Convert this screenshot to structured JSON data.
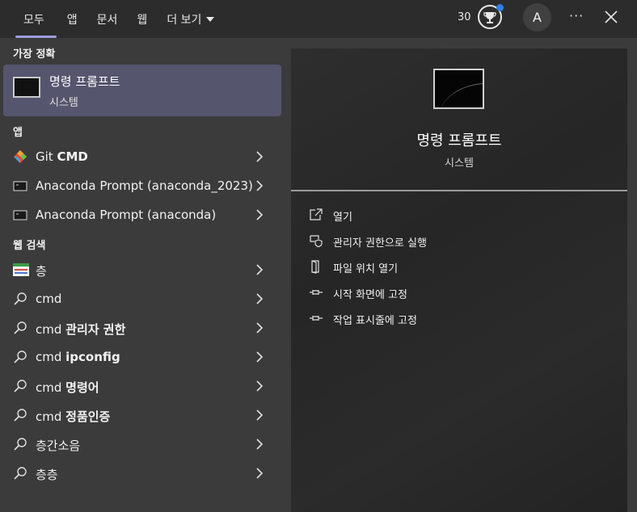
{
  "tabs": [
    {
      "label": "모두",
      "active": true
    },
    {
      "label": "앱"
    },
    {
      "label": "문서"
    },
    {
      "label": "웹"
    },
    {
      "label": "더 보기"
    }
  ],
  "header": {
    "points": "30",
    "avatar_initial": "A",
    "more_label": "···"
  },
  "best_match": {
    "section_label": "가장 정확",
    "title": "명령 프롬프트",
    "subtitle": "시스템"
  },
  "apps": {
    "section_label": "앱",
    "items": [
      {
        "label_plain": "Git ",
        "label_bold": "CMD",
        "icon": "git-icon"
      },
      {
        "label_plain": "Anaconda Prompt (anaconda_2023)",
        "label_bold": "",
        "icon": "terminal-icon"
      },
      {
        "label_plain": "Anaconda Prompt (anaconda)",
        "label_bold": "",
        "icon": "terminal-icon"
      }
    ]
  },
  "web": {
    "section_label": "웹 검색",
    "items": [
      {
        "label_plain": "층",
        "label_bold": "",
        "icon": "web-thumbnail-icon"
      },
      {
        "label_plain": "cmd",
        "label_bold": "",
        "icon": "search-icon"
      },
      {
        "label_plain": "cmd ",
        "label_bold": "관리자 권한",
        "icon": "search-icon"
      },
      {
        "label_plain": "cmd ",
        "label_bold": "ipconfig",
        "icon": "search-icon"
      },
      {
        "label_plain": "cmd ",
        "label_bold": "명령어",
        "icon": "search-icon"
      },
      {
        "label_plain": "cmd ",
        "label_bold": "정품인증",
        "icon": "search-icon"
      },
      {
        "label_plain": "층간소음",
        "label_bold": "",
        "icon": "search-icon"
      },
      {
        "label_plain": "층층",
        "label_bold": "",
        "icon": "search-icon"
      }
    ]
  },
  "detail": {
    "title": "명령 프롬프트",
    "subtitle": "시스템",
    "actions": [
      {
        "label": "열기",
        "icon": "open-icon"
      },
      {
        "label": "관리자 권한으로 실행",
        "icon": "shield-icon"
      },
      {
        "label": "파일 위치 열기",
        "icon": "folder-icon"
      },
      {
        "label": "시작 화면에 고정",
        "icon": "pin-icon"
      },
      {
        "label": "작업 표시줄에 고정",
        "icon": "pin-icon"
      }
    ]
  },
  "colors": {
    "accent": "#9e9ce0",
    "selected_bg": "#55556e",
    "notification_dot": "#2f7fe6"
  }
}
